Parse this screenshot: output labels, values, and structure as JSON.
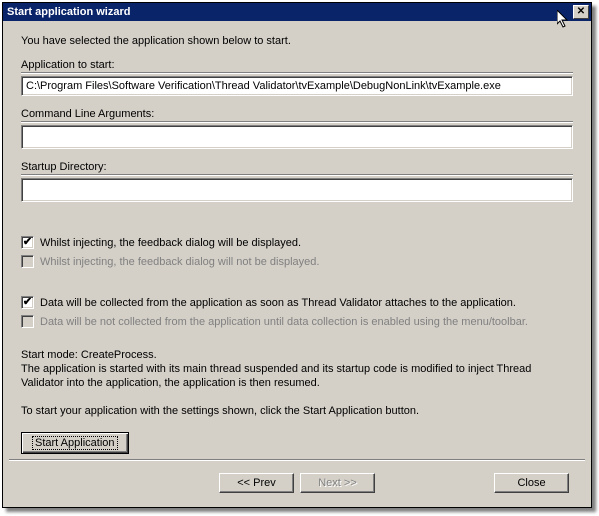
{
  "title": "Start application wizard",
  "intro": "You have selected the application shown below to start.",
  "app_label": "Application to start:",
  "app_value": "C:\\Program Files\\Software Verification\\Thread Validator\\tvExample\\DebugNonLink\\tvExample.exe",
  "cmd_label": "Command Line Arguments:",
  "cmd_value": "",
  "startup_label": "Startup Directory:",
  "startup_value": "",
  "chk1": "Whilst injecting, the feedback dialog will be displayed.",
  "chk2": "Whilst injecting, the feedback dialog will not be displayed.",
  "chk3": "Data will be collected from the application as soon as Thread Validator attaches to the application.",
  "chk4": "Data will be not collected from the application until data collection is enabled using the menu/toolbar.",
  "mode_line1": "Start mode: CreateProcess.",
  "mode_line2": "The application is started with its main thread suspended and its startup code is modified to inject Thread Validator into the application, the application is then resumed.",
  "instruction": "To start your application with the settings shown, click the Start Application button.",
  "start_btn": "Start Application",
  "prev_btn": "<< Prev",
  "next_btn": "Next >>",
  "close_btn": "Close"
}
